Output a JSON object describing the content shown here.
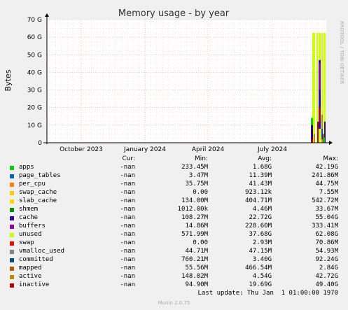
{
  "chart_data": {
    "type": "area",
    "title": "Memory usage - by year",
    "ylabel": "Bytes",
    "watermark": "RRDTOOL / TOBI OETIKER",
    "y_ticks": [
      "0",
      "10 G",
      "20 G",
      "30 G",
      "40 G",
      "50 G",
      "60 G",
      "70 G"
    ],
    "y_tick_values": [
      0,
      10,
      20,
      30,
      40,
      50,
      60,
      70
    ],
    "ylim": [
      0,
      70
    ],
    "y_unit": "G",
    "x_ticks": [
      "October 2023",
      "January 2024",
      "April 2024",
      "July 2024"
    ],
    "grid": true,
    "series_columns": [
      "Cur:",
      "Min:",
      "Avg:",
      "Max:"
    ],
    "series": [
      {
        "name": "apps",
        "color": "#00cc00",
        "cur": "-nan",
        "min": "233.45M",
        "avg": "1.68G",
        "max": "42.19G"
      },
      {
        "name": "page_tables",
        "color": "#0066b3",
        "cur": "-nan",
        "min": "3.47M",
        "avg": "11.39M",
        "max": "241.86M"
      },
      {
        "name": "per_cpu",
        "color": "#ff8000",
        "cur": "-nan",
        "min": "35.75M",
        "avg": "41.43M",
        "max": "44.75M"
      },
      {
        "name": "swap_cache",
        "color": "#ffcc00",
        "cur": "-nan",
        "min": "0.00",
        "avg": "923.12k",
        "max": "7.55M"
      },
      {
        "name": "slab_cache",
        "color": "#ffd700",
        "cur": "-nan",
        "min": "134.00M",
        "avg": "404.71M",
        "max": "542.72M"
      },
      {
        "name": "shmem",
        "color": "#008f00",
        "cur": "-nan",
        "min": "1012.00k",
        "avg": "4.46M",
        "max": "33.67M"
      },
      {
        "name": "cache",
        "color": "#330099",
        "cur": "-nan",
        "min": "108.27M",
        "avg": "22.72G",
        "max": "55.04G"
      },
      {
        "name": "buffers",
        "color": "#990099",
        "cur": "-nan",
        "min": "14.86M",
        "avg": "228.60M",
        "max": "333.41M"
      },
      {
        "name": "unused",
        "color": "#ccff00",
        "cur": "-nan",
        "min": "571.99M",
        "avg": "37.68G",
        "max": "62.08G"
      },
      {
        "name": "swap",
        "color": "#ff0000",
        "cur": "-nan",
        "min": "0.00",
        "avg": "2.93M",
        "max": "70.86M"
      },
      {
        "name": "vmalloc_used",
        "color": "#808080",
        "cur": "-nan",
        "min": "44.71M",
        "avg": "47.15M",
        "max": "54.93M"
      },
      {
        "name": "committed",
        "color": "#004d80",
        "cur": "-nan",
        "min": "760.21M",
        "avg": "3.40G",
        "max": "92.24G"
      },
      {
        "name": "mapped",
        "color": "#b35a00",
        "cur": "-nan",
        "min": "55.56M",
        "avg": "466.54M",
        "max": "2.84G"
      },
      {
        "name": "active",
        "color": "#b38f00",
        "cur": "-nan",
        "min": "148.02M",
        "avg": "4.54G",
        "max": "42.72G"
      },
      {
        "name": "inactive",
        "color": "#b30000",
        "cur": "-nan",
        "min": "94.90M",
        "avg": "19.69G",
        "max": "49.40G"
      }
    ],
    "data_window": {
      "description_hidden": true
    }
  },
  "footer": {
    "last_update": "Last update: Thu Jan  1 01:00:00 1970",
    "munin": "Munin 2.0.75"
  }
}
